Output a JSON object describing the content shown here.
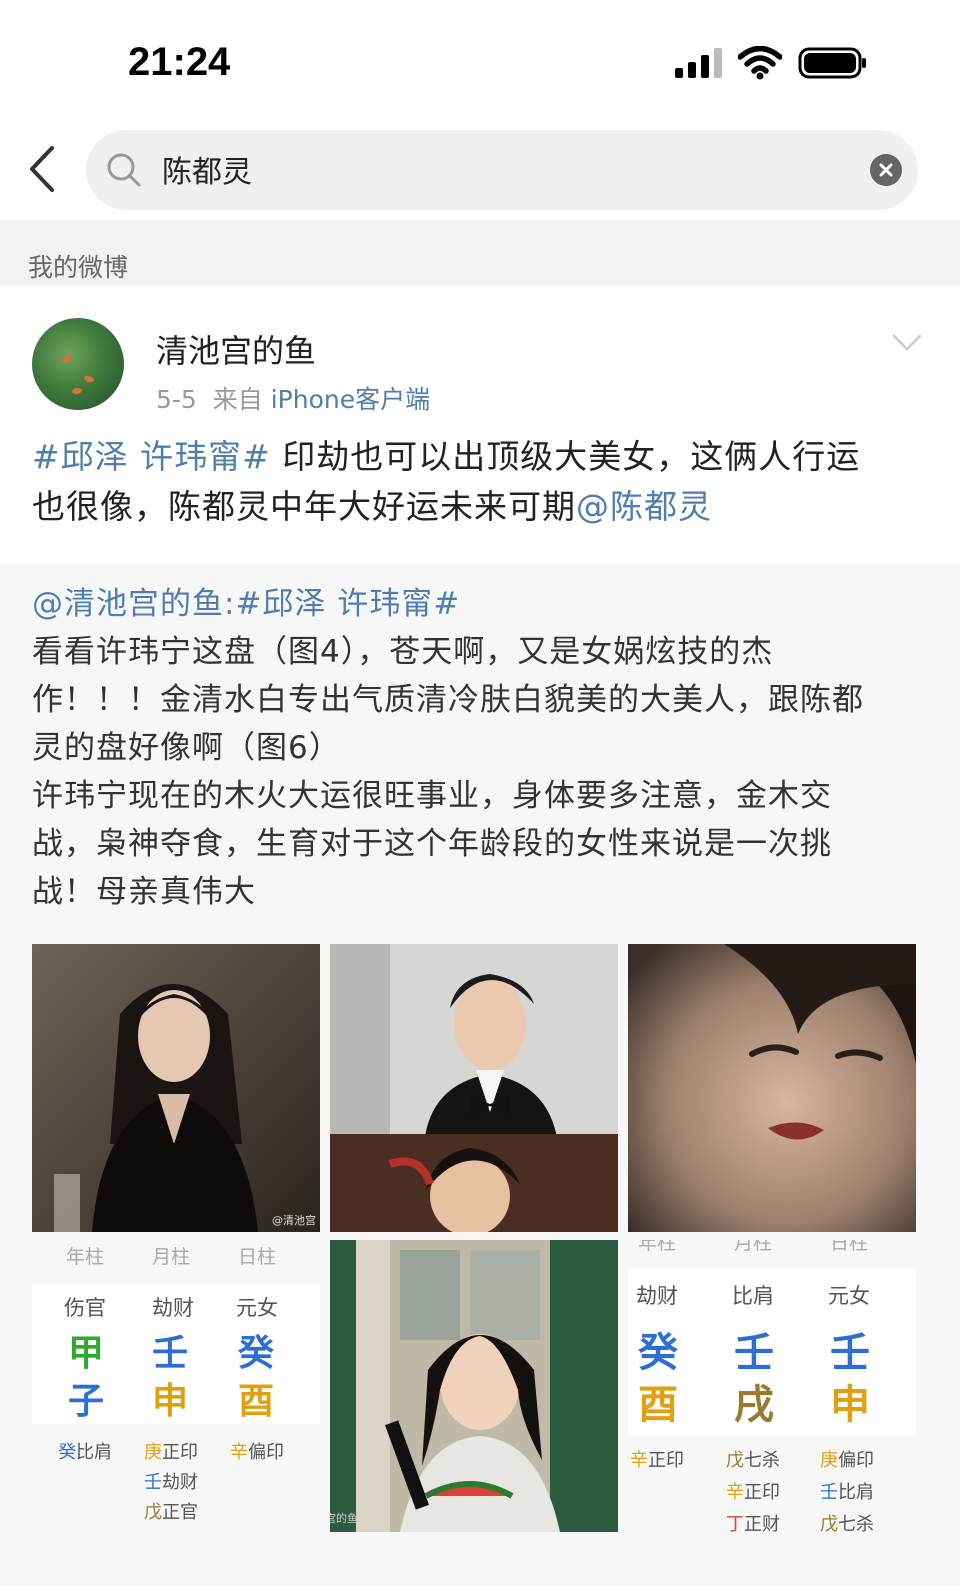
{
  "status_bar": {
    "time": "21:24"
  },
  "search": {
    "query": "陈都灵"
  },
  "section": {
    "label": "我的微博"
  },
  "post": {
    "username": "清池宫的鱼",
    "date": "5-5",
    "source_prefix": "来自",
    "source": "iPhone客户端",
    "hashtag": "#邱泽 许玮甯#",
    "text_1": " 印劫也可以出顶级大美女，这俩人行运",
    "text_2": "也很像，陈都灵中年大好运未来可期",
    "mention": "@陈都灵"
  },
  "repost": {
    "author_mention": "@清池宫的鱼",
    "separator": ":",
    "hashtag": "#邱泽 许玮甯#",
    "line_1": "看看许玮宁这盘（图4），苍天啊，又是女娲炫技的杰",
    "line_2": "作！！！金清水白专出气质清冷肤白貌美的大美人，跟陈都",
    "line_3": "灵的盘好像啊（图6）",
    "line_4": "许玮宁现在的木火大运很旺事业，身体要多注意，金木交",
    "line_5": "战，枭神夺食，生育对于这个年龄段的女性来说是一次挑",
    "line_6": "战！母亲真伟大"
  },
  "images": {
    "watermark_1": "@清池宫",
    "watermark_5": "微博@清池宫的鱼"
  },
  "chart_left": {
    "headers": [
      "年柱",
      "月柱",
      "日柱"
    ],
    "gods": [
      "伤官",
      "劫财",
      "元女"
    ],
    "stems": [
      "甲",
      "壬",
      "癸"
    ],
    "branches": [
      "子",
      "申",
      "酉"
    ],
    "stem_colors": [
      "#2ea82e",
      "#2b6fd6",
      "#2b6fd6"
    ],
    "branch_colors": [
      "#2b6fd6",
      "#e0a012",
      "#e0a012"
    ],
    "hidden_col1_char": "癸",
    "hidden_col1_text": "比肩",
    "hidden_col2a_char": "庚",
    "hidden_col2a_text": "正印",
    "hidden_col2b_char": "壬",
    "hidden_col2b_text": "劫财",
    "hidden_col2c_char": "戊",
    "hidden_col2c_text": "正官",
    "hidden_col3_char": "辛",
    "hidden_col3_text": "偏印"
  },
  "chart_right": {
    "headers": [
      "年柱",
      "月柱",
      "日柱"
    ],
    "gods": [
      "劫财",
      "比肩",
      "元女"
    ],
    "stems": [
      "癸",
      "壬",
      "壬"
    ],
    "branches": [
      "酉",
      "戌",
      "申"
    ],
    "stem_colors": [
      "#2b6fd6",
      "#2b6fd6",
      "#2b6fd6"
    ],
    "branch_colors": [
      "#e0a012",
      "#9a7a2e",
      "#e0a012"
    ],
    "hidden_col1_char": "辛",
    "hidden_col1_text": "正印",
    "hidden_col2a_char": "戊",
    "hidden_col2a_text": "七杀",
    "hidden_col2b_char": "辛",
    "hidden_col2b_text": "正印",
    "hidden_col2c_char": "丁",
    "hidden_col2c_text": "正财",
    "hidden_col3a_char": "庚",
    "hidden_col3a_text": "偏印",
    "hidden_col3b_char": "壬",
    "hidden_col3b_text": "比肩",
    "hidden_col3c_char": "戊",
    "hidden_col3c_text": "七杀"
  }
}
